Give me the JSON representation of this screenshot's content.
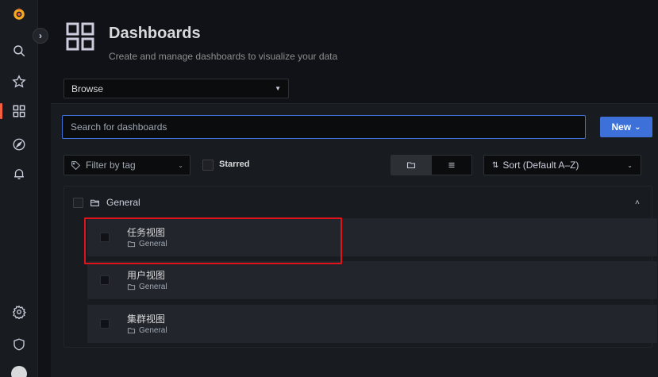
{
  "header": {
    "title": "Dashboards",
    "subtitle": "Create and manage dashboards to visualize your data"
  },
  "sidebar": {
    "items": [
      {
        "icon": "grafana-logo-icon"
      },
      {
        "icon": "search-icon"
      },
      {
        "icon": "star-icon"
      },
      {
        "icon": "dashboards-icon",
        "active": true
      },
      {
        "icon": "explore-compass-icon"
      },
      {
        "icon": "alerting-bell-icon"
      },
      {
        "icon": "gear-icon"
      },
      {
        "icon": "shield-icon"
      },
      {
        "icon": "user-avatar"
      }
    ],
    "expand_glyph": "›"
  },
  "browse": {
    "selected": "Browse"
  },
  "search": {
    "placeholder": "Search for dashboards"
  },
  "new_button": {
    "label": "New",
    "caret": "⌄"
  },
  "filters": {
    "tag_placeholder": "Filter by tag",
    "starred_label": "Starred",
    "sort_label": "Sort (Default A–Z)"
  },
  "folder": {
    "name": "General",
    "collapse_glyph": "˄",
    "dashboards": [
      {
        "title": "任务视图",
        "folder": "General"
      },
      {
        "title": "用户视图",
        "folder": "General"
      },
      {
        "title": "集群视图",
        "folder": "General"
      }
    ]
  },
  "colors": {
    "accent": "#3d71d9",
    "brand": "#f55f3e",
    "highlight": "#e0121a",
    "background": "#111217",
    "panel": "#181b1f"
  }
}
